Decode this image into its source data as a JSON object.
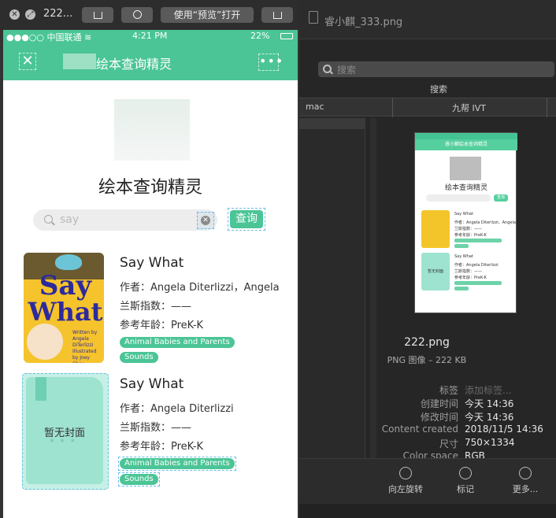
{
  "quicklook": {
    "filename": "222...",
    "open_with": "使用“预览”打开",
    "close_glyph": "✕",
    "fullscreen_glyph": "⤢"
  },
  "phone": {
    "status": {
      "carrier": "●●●○○ 中国联通 ≋",
      "time": "4:21 PM",
      "battery": "22%"
    },
    "nav": {
      "title": "绘本查询精灵",
      "close": "✕",
      "more": "•••"
    },
    "heading": "绘本查询精灵",
    "search": {
      "value": "say",
      "clear": "✕",
      "button": "查询"
    },
    "books": [
      {
        "title": "Say What",
        "author_label": "作者：",
        "author": "Angela Diterlizzi，Angela",
        "lexile_label": "兰斯指数：",
        "lexile": "——",
        "age_label": "参考年龄：",
        "age": "PreK-K",
        "tags": [
          "Animal Babies and Parents",
          "Sounds"
        ],
        "cover": {
          "line1": "Say",
          "line2": "What",
          "credit": "Written by Angela DiTerlizzi  Illustrated by Joey Chou"
        }
      },
      {
        "title": "Say What",
        "author_label": "作者：",
        "author": "Angela Diterlizzi",
        "lexile_label": "兰斯指数：",
        "lexile": "——",
        "age_label": "参考年龄：",
        "age": "PreK-K",
        "tags": [
          "Animal Babies and Parents",
          "Sounds"
        ],
        "cover": {
          "no_cover": "暂无封面",
          "stars": "★★★"
        }
      }
    ]
  },
  "finder": {
    "window_title": "睿小麒_333.png",
    "search_placeholder": "搜索",
    "search_label": "搜索",
    "columns": [
      "mac",
      "九帮 IVT"
    ],
    "thumbnail": {
      "nav_title": "睿小麒绘本查询精灵",
      "heading": "绘本查询精灵",
      "query": "查询",
      "item1_lines": [
        "Say What",
        "作者：Angela Diterlizzi，Angela",
        "兰斯指数：——",
        "参考年龄：PreK-K"
      ],
      "item2_lines": [
        "Say What",
        "作者：Angela Diterlizzi",
        "兰斯指数：——",
        "参考年龄：PreK-K"
      ],
      "no_cover": "暂无封面"
    },
    "file": {
      "name": "222.png",
      "kind_size": "PNG 图像 – 222 KB"
    },
    "meta": [
      {
        "key": "标签",
        "value": "添加标签...",
        "dim": true
      },
      {
        "key": "创建时间",
        "value": "今天 14:36"
      },
      {
        "key": "修改时间",
        "value": "今天 14:36"
      },
      {
        "key": "Content created",
        "value": "2018/11/5 14:36"
      },
      {
        "key": "尺寸",
        "value": "750×1334"
      },
      {
        "key": "Color space",
        "value": "RGB"
      }
    ],
    "actions": [
      "向左旋转",
      "标记",
      "更多..."
    ]
  }
}
